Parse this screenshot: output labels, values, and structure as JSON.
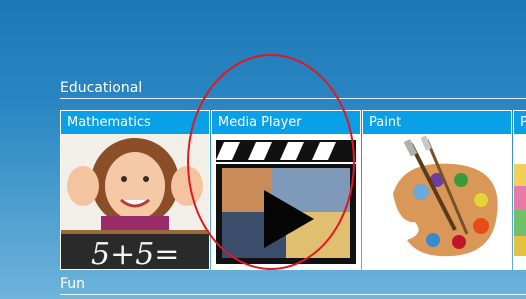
{
  "sections": [
    {
      "label": "Educational"
    },
    {
      "label": "Fun"
    }
  ],
  "tiles": [
    {
      "label": "Mathematics",
      "board_text": "5+5="
    },
    {
      "label": "Media Player"
    },
    {
      "label": "Paint"
    },
    {
      "label": "P"
    }
  ],
  "colors": {
    "tile_header": "#0aa0e8",
    "highlight": "#e0181f"
  }
}
